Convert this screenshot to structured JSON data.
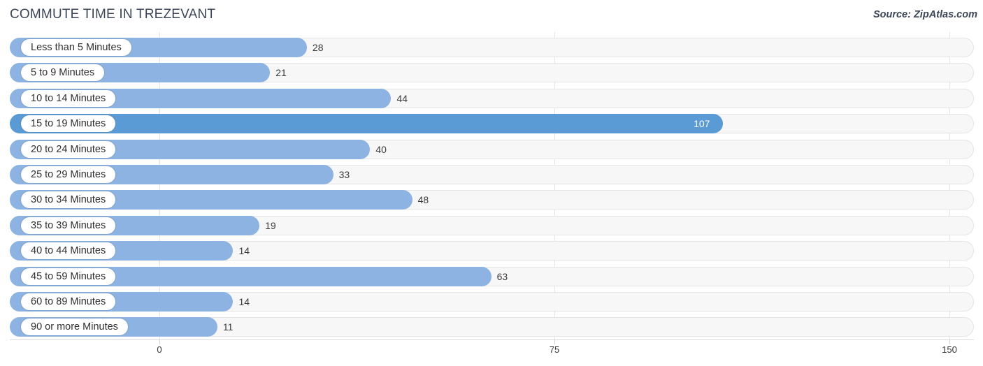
{
  "header": {
    "title": "COMMUTE TIME IN TREZEVANT",
    "source": "Source: ZipAtlas.com"
  },
  "colors": {
    "bar": "#8cb3e2",
    "bar_max": "#5b9bd5",
    "track": "#f7f7f7",
    "track_border": "#e4e4e4",
    "gridline": "#e2e2e2",
    "title_text": "#3c4656",
    "value_text": "#3a3a3a",
    "value_text_inside": "#ffffff"
  },
  "axis": {
    "ticks": [
      "0",
      "75",
      "150"
    ],
    "tick_values": [
      0,
      75,
      150
    ],
    "min": 0,
    "max": 150
  },
  "chart_data": {
    "type": "bar",
    "orientation": "horizontal",
    "title": "COMMUTE TIME IN TREZEVANT",
    "subtitle": "",
    "xlabel": "",
    "ylabel": "",
    "xlim": [
      0,
      150
    ],
    "grid": true,
    "legend": null,
    "source": "Source: ZipAtlas.com",
    "categories": [
      "Less than 5 Minutes",
      "5 to 9 Minutes",
      "10 to 14 Minutes",
      "15 to 19 Minutes",
      "20 to 24 Minutes",
      "25 to 29 Minutes",
      "30 to 34 Minutes",
      "35 to 39 Minutes",
      "40 to 44 Minutes",
      "45 to 59 Minutes",
      "60 to 89 Minutes",
      "90 or more Minutes"
    ],
    "values": [
      28,
      21,
      44,
      107,
      40,
      33,
      48,
      19,
      14,
      63,
      14,
      11
    ],
    "value_labels": [
      "28",
      "21",
      "44",
      "107",
      "40",
      "33",
      "48",
      "19",
      "14",
      "63",
      "14",
      "11"
    ],
    "highlighted_index": 3
  }
}
